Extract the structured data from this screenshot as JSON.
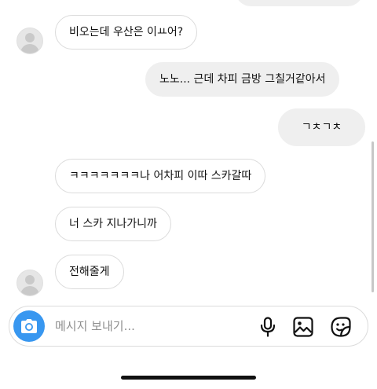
{
  "messages": [
    {
      "from": "them",
      "text": "비오는데 우산은 이ㅛ어?"
    },
    {
      "from": "me",
      "text": "노노... 근데 차피 금방 그칠거같아서"
    },
    {
      "from": "me",
      "text": "ㄱㅊㄱㅊ"
    },
    {
      "from": "them",
      "text": "ㅋㅋㅋㅋㅋㅋㅋ나 어차피 이따 스카갈따"
    },
    {
      "from": "them",
      "text": "너 스카 지나가니까"
    },
    {
      "from": "them",
      "text": "전해줄게"
    }
  ],
  "composer": {
    "placeholder": "메시지 보내기...",
    "icons": [
      "camera-icon",
      "microphone-icon",
      "image-icon",
      "sticker-icon"
    ]
  },
  "colors": {
    "accent": "#3897f0",
    "incoming_bubble": "#ffffff",
    "outgoing_bubble": "#efefef",
    "border": "#dbdbdb",
    "placeholder": "#8e8e8e"
  }
}
